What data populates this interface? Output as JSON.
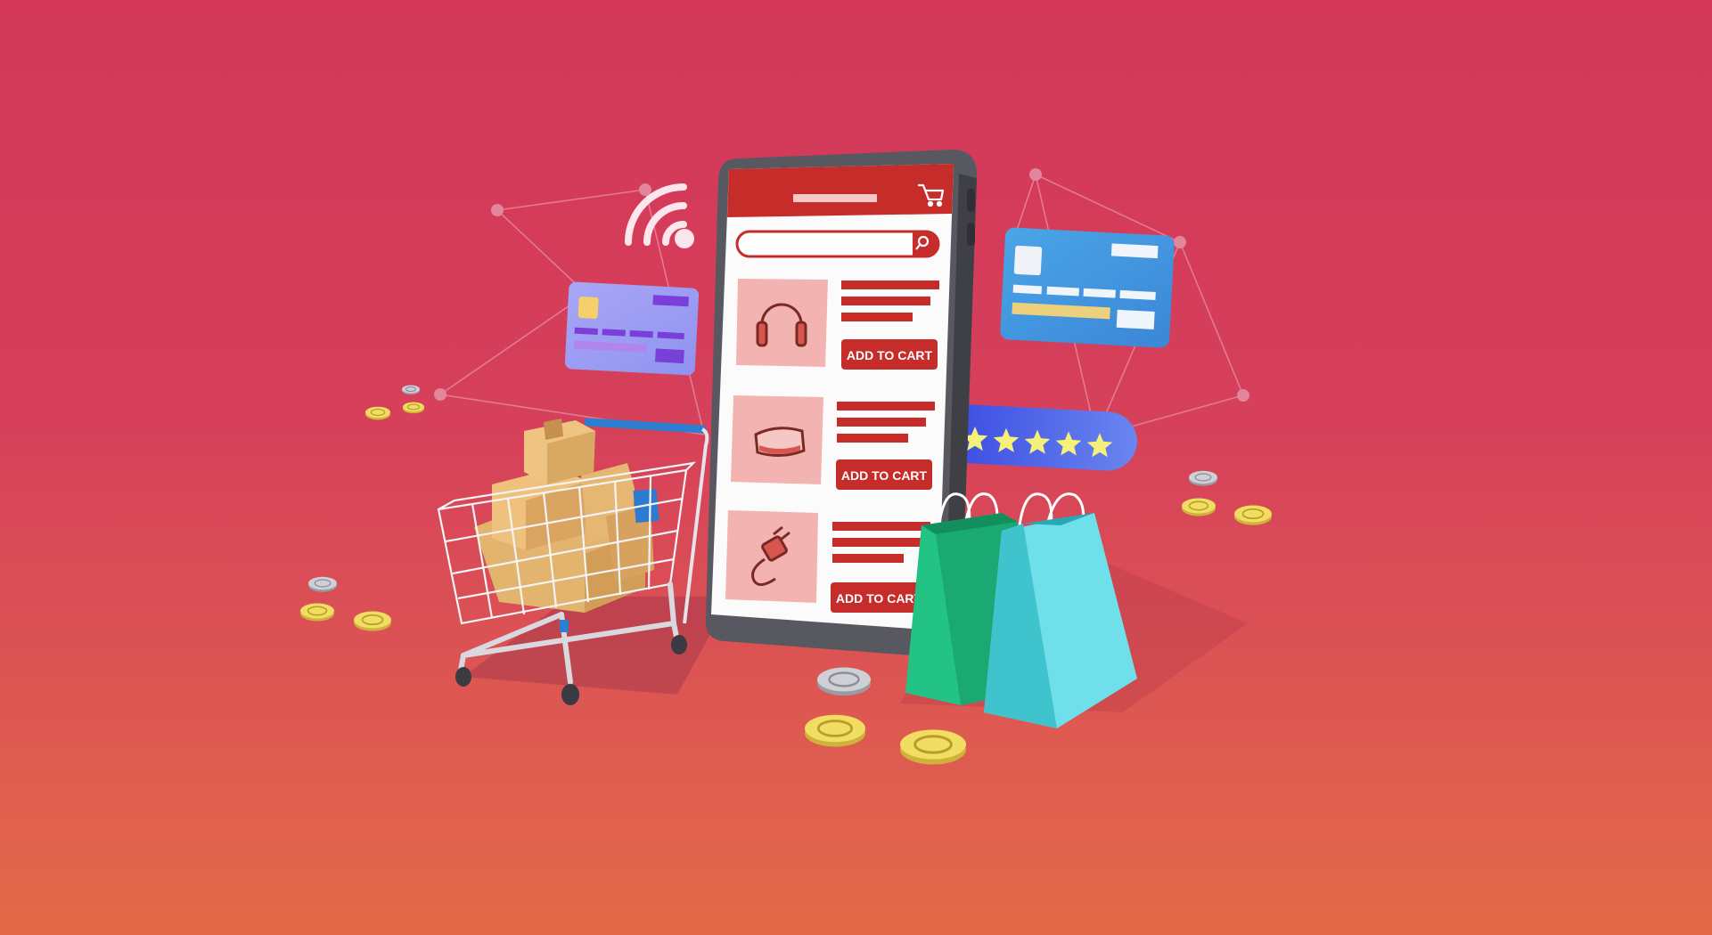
{
  "products": [
    {
      "icon": "headphones-icon",
      "button_label": "ADD TO CART"
    },
    {
      "icon": "vr-headset-icon",
      "button_label": "ADD TO CART"
    },
    {
      "icon": "charger-plug-icon",
      "button_label": "ADD TO CART"
    }
  ],
  "rating": {
    "stars": 5,
    "max": 5
  },
  "colors": {
    "background_top": "#d23759",
    "background_bottom": "#e26a47",
    "app_red": "#c62d2a",
    "product_tile": "#f3b3b0",
    "bag_green": "#20c383",
    "bag_cyan": "#6fdfe9",
    "coin_gold": "#f1dd62",
    "card_purple": "#a4a2f4",
    "card_blue": "#4394de",
    "rating_blue": "#4558e6",
    "star_yellow": "#f4f07a"
  }
}
